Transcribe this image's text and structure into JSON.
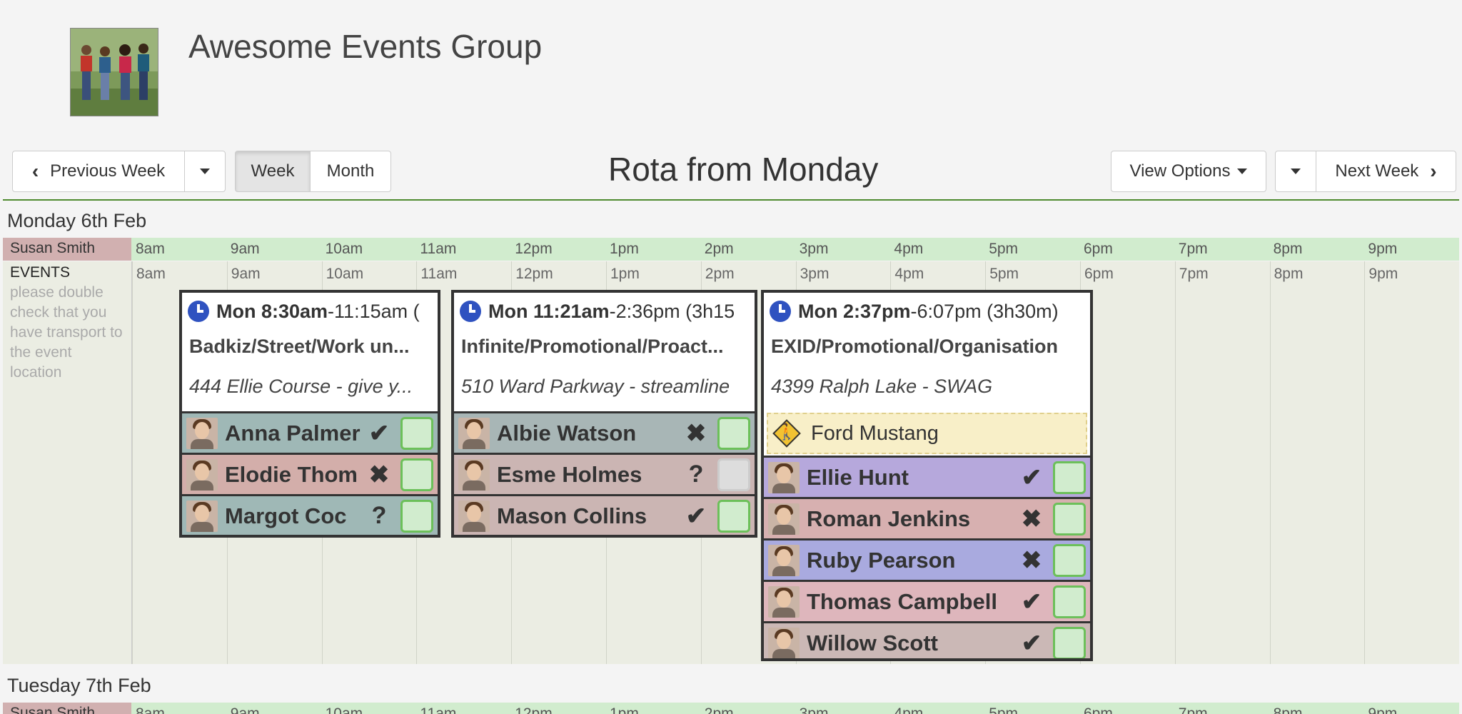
{
  "header": {
    "title": "Awesome Events Group"
  },
  "toolbar": {
    "prev_week": "Previous Week",
    "week": "Week",
    "month": "Month",
    "title": "Rota from Monday",
    "view_options": "View Options",
    "next_week": "Next Week"
  },
  "hours": [
    "8am",
    "9am",
    "10am",
    "11am",
    "12pm",
    "1pm",
    "2pm",
    "3pm",
    "4pm",
    "5pm",
    "6pm",
    "7pm",
    "8pm",
    "9pm"
  ],
  "days": [
    {
      "title": "Monday 6th Feb",
      "staff": "Susan Smith",
      "events_label": "EVENTS",
      "events_note": "please double check that you have transport to the event location"
    },
    {
      "title": "Tuesday 7th Feb",
      "staff": "Susan Smith"
    }
  ],
  "events": [
    {
      "time_bold": "Mon 8:30am",
      "time_rest": "-11:15am (",
      "name": "Badkiz/Street/Work un...",
      "location": "444 Ellie Course - give y...",
      "people": [
        {
          "name": "Anna Palmer",
          "status": "✔",
          "color": "#9fb8b6"
        },
        {
          "name": "Elodie Thom",
          "status": "✖",
          "color": "#d3aeaa"
        },
        {
          "name": "Margot Coc",
          "status": "?",
          "color": "#9fb8b6"
        }
      ]
    },
    {
      "time_bold": "Mon 11:21am",
      "time_rest": "-2:36pm (3h15",
      "name": "Infinite/Promotional/Proact...",
      "location": "510 Ward Parkway - streamline",
      "people": [
        {
          "name": "Albie Watson",
          "status": "✖",
          "color": "#a8b6b6"
        },
        {
          "name": "Esme Holmes",
          "status": "?",
          "color": "#cbb5b3"
        },
        {
          "name": "Mason Collins",
          "status": "✔",
          "color": "#cbb5b3"
        }
      ]
    },
    {
      "time_bold": "Mon 2:37pm",
      "time_rest": "-6:07pm (3h30m)",
      "name": "EXID/Promotional/Organisation",
      "location": "4399 Ralph Lake - SWAG",
      "vehicle": "Ford Mustang",
      "people": [
        {
          "name": "Ellie Hunt",
          "status": "✔",
          "color": "#b6a8dc"
        },
        {
          "name": "Roman Jenkins",
          "status": "✖",
          "color": "#d7b0b0"
        },
        {
          "name": "Ruby Pearson",
          "status": "✖",
          "color": "#a9aadf"
        },
        {
          "name": "Thomas Campbell",
          "status": "✔",
          "color": "#deb6bc"
        },
        {
          "name": "Willow Scott",
          "status": "✔",
          "color": "#cbb8b6"
        }
      ]
    }
  ]
}
